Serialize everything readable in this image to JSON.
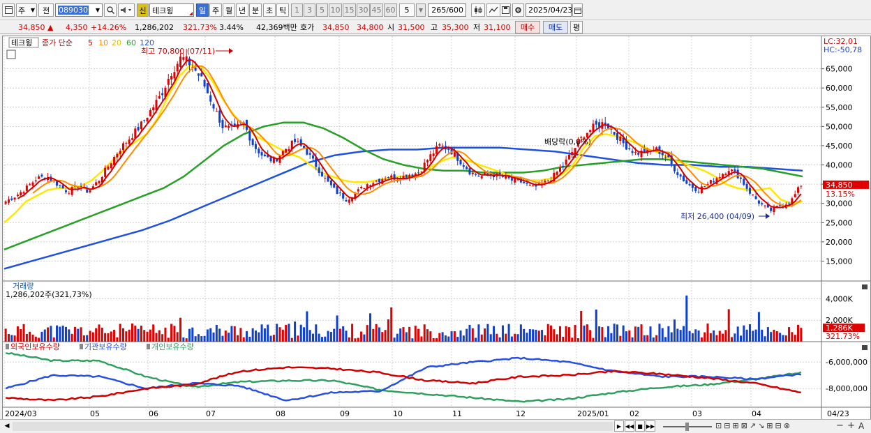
{
  "toolbar": {
    "period_type": "주",
    "prev_label": "전",
    "code": "089030",
    "new_badge": "신",
    "stock_name": "테크윙",
    "periods": [
      "일",
      "주",
      "월",
      "년",
      "분",
      "초",
      "틱"
    ],
    "active_period": "일",
    "intervals": [
      "1",
      "3",
      "5",
      "10",
      "15",
      "30",
      "45",
      "60"
    ],
    "interval_value": "5",
    "count": "265",
    "count_max": "/600",
    "date": "2025/04/23"
  },
  "quote": {
    "price": "34,850",
    "up_arrow": "▲",
    "change": "4,350",
    "change_pct": "+14.26%",
    "volume": "1,286,202",
    "volume_ratio": "321.73%",
    "turnover": "3.44%",
    "amount": "42,369백만",
    "hoga_label": "호가",
    "ask": "34,850",
    "bid": "34,800",
    "open_label": "시",
    "open": "31,500",
    "high_label": "고",
    "high": "35,300",
    "low_label": "저",
    "low": "31,100",
    "buy_label": "매수",
    "sell_label": "매도",
    "eval_label": "평"
  },
  "legend": {
    "name": "테크윙",
    "ma_label": "종가 단순",
    "ma_periods": [
      "5",
      "10",
      "20",
      "60",
      "120"
    ],
    "ma_colors": [
      "#d00000",
      "#ff8c00",
      "#ffe800",
      "#28a028",
      "#2050e0"
    ]
  },
  "annotations": {
    "max_label": "최고 70,800 (07/11)",
    "min_label": "최저 26,400 (04/09)",
    "dividend": "배당락(0,0%)",
    "lc": "LC:32,01",
    "hc": "HC:-50,78",
    "last_price": "34,850",
    "last_pct": "13.15%",
    "vol_last": "1,286K",
    "vol_last_pct": "321.73%"
  },
  "volume_panel": {
    "title": "거래량",
    "value": "1,286,202주(321,73%)"
  },
  "holdings_panel": {
    "series": [
      "외국인보유수량",
      "기관보유수량",
      "개인보유수량"
    ],
    "colors": [
      "#d00000",
      "#2850e0",
      "#30a060"
    ]
  },
  "chart_data": {
    "type": "candlestick",
    "price_axis": [
      "65,000",
      "60,000",
      "55,000",
      "50,000",
      "45,000",
      "40,000",
      "35,000",
      "30,000",
      "25,000",
      "20,000",
      "15,000"
    ],
    "price_ylim": [
      10000,
      72000
    ],
    "volume_axis": [
      "4,000K",
      "2,000K"
    ],
    "holdings_axis": [
      "-6,000,000",
      "-8,000,000"
    ],
    "x_labels": [
      "2024/03",
      "05",
      "06",
      "07",
      "08",
      "09",
      "10",
      "11",
      "12",
      "2025/01",
      "02",
      "03",
      "04",
      "04/23"
    ],
    "close_trace": [
      30500,
      32000,
      34000,
      36500,
      37000,
      35000,
      33000,
      34500,
      33000,
      36000,
      40000,
      44000,
      47000,
      50000,
      54000,
      58000,
      64000,
      68000,
      66000,
      62000,
      56000,
      50000,
      49000,
      51000,
      45000,
      42000,
      41000,
      44000,
      46000,
      44000,
      40000,
      36000,
      33000,
      31000,
      33000,
      35000,
      36000,
      37000,
      36500,
      37500,
      38000,
      42000,
      45000,
      44000,
      41000,
      38000,
      37000,
      37500,
      37000,
      36000,
      35500,
      34000,
      35000,
      37000,
      40000,
      44000,
      48000,
      50000,
      51000,
      48000,
      45000,
      43000,
      43500,
      44000,
      42000,
      38000,
      35000,
      33500,
      35000,
      37000,
      39000,
      37000,
      33000,
      30000,
      28000,
      29500,
      30500,
      34850
    ],
    "ma20_trace": [
      25000,
      27500,
      30500,
      32000,
      33500,
      34000,
      34000,
      34500,
      36000,
      38500,
      41500,
      44000,
      46000,
      48000,
      52000,
      58000,
      63000,
      66000,
      65500,
      62000,
      57000,
      53000,
      50000,
      47500,
      46000,
      44500,
      43000,
      42000,
      40000,
      38000,
      37000,
      36000,
      35500,
      35500,
      36000,
      36500,
      37000,
      37000,
      37500,
      39500,
      41000,
      42000,
      41500,
      40500,
      39500,
      38500,
      37500,
      36500,
      36000,
      36000,
      36500,
      37500,
      40000,
      44500,
      47500,
      48000,
      47500,
      46500,
      45500,
      44000,
      43000,
      41500,
      40500,
      39500,
      38500,
      37000,
      35000,
      34000,
      33500,
      33500,
      34000,
      31000,
      30000,
      30500
    ],
    "ma60_trace": [
      18000,
      20000,
      22000,
      24000,
      26000,
      28000,
      30000,
      32000,
      34000,
      37000,
      41000,
      45000,
      48000,
      50000,
      51000,
      51000,
      49500,
      47000,
      44000,
      41500,
      40000,
      39000,
      38500,
      38500,
      38000,
      38000,
      38000,
      38500,
      39500,
      40000,
      40500,
      41000,
      41500,
      41500,
      41000,
      40500,
      40000,
      39500,
      39000,
      38000,
      37000
    ],
    "ma120_trace": [
      13000,
      15000,
      17000,
      19000,
      21000,
      23000,
      25500,
      28500,
      31500,
      34500,
      37500,
      40500,
      42500,
      43500,
      44000,
      44000,
      44500,
      44500,
      44500,
      44000,
      43500,
      42500,
      41500,
      40500,
      40000,
      40000,
      39500,
      39500,
      39000,
      38500
    ]
  }
}
